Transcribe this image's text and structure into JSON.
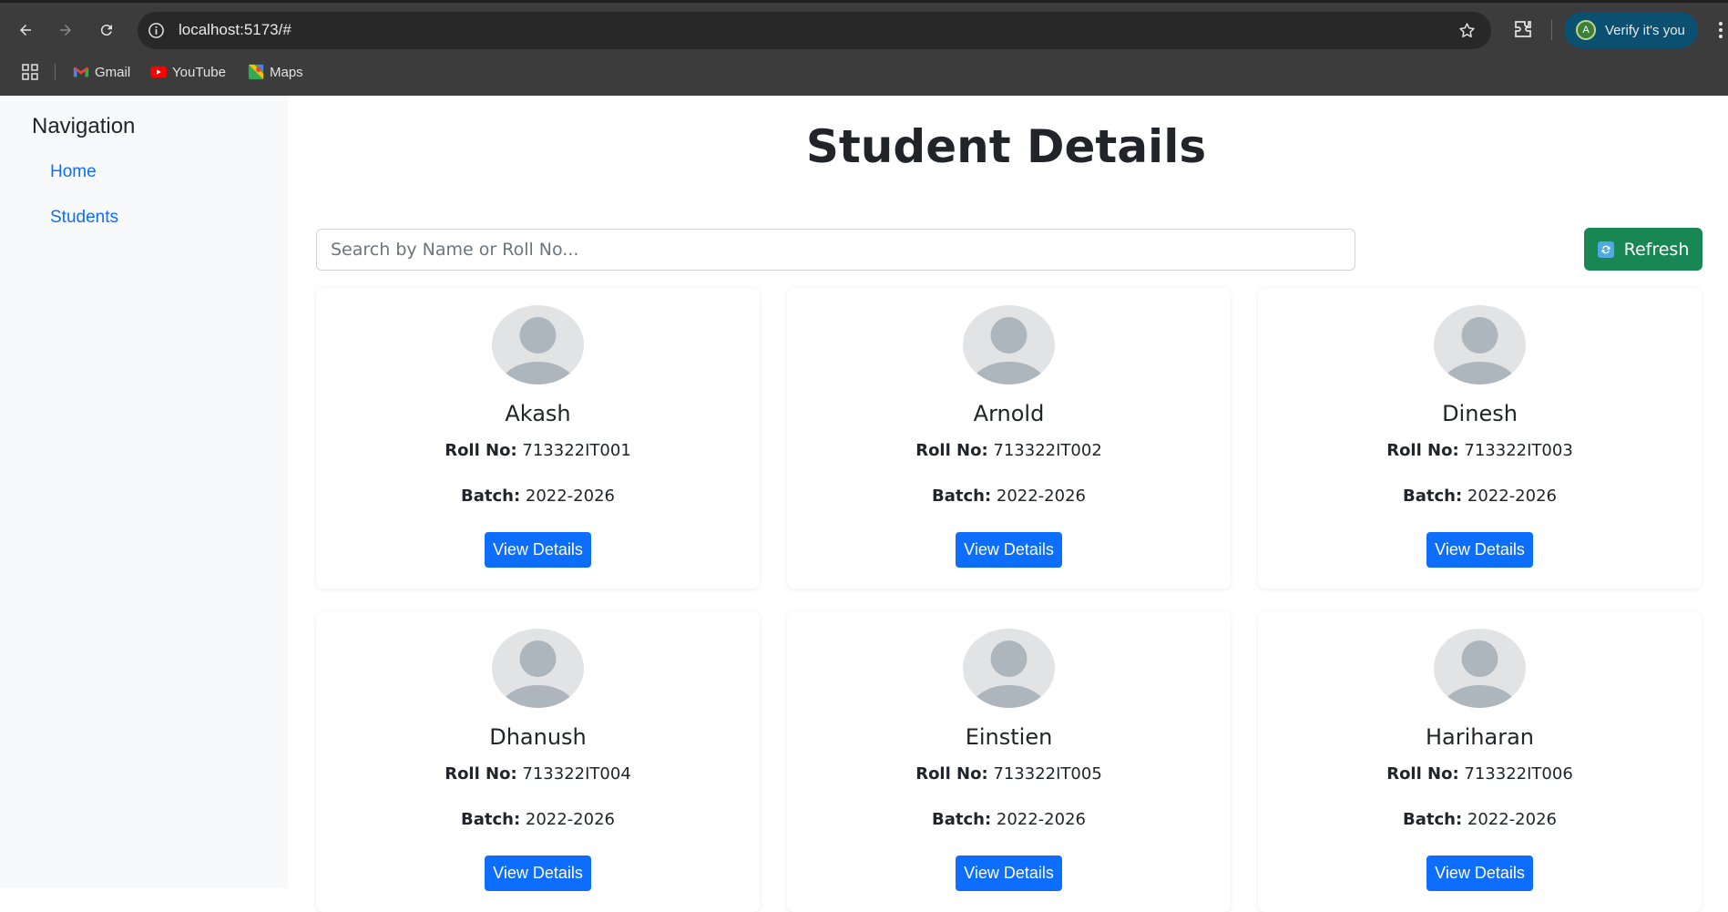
{
  "browser": {
    "url": "localhost:5173/#",
    "profile_label": "Verify it's you",
    "profile_initial": "A",
    "bookmarks": [
      {
        "label": "Gmail",
        "icon": "gmail-icon"
      },
      {
        "label": "YouTube",
        "icon": "youtube-icon"
      },
      {
        "label": "Maps",
        "icon": "maps-icon"
      }
    ]
  },
  "sidebar": {
    "title": "Navigation",
    "links": [
      {
        "label": "Home"
      },
      {
        "label": "Students"
      }
    ]
  },
  "main": {
    "title": "Student Details",
    "search_placeholder": "Search by Name or Roll No...",
    "refresh_label": "Refresh",
    "roll_label": "Roll No:",
    "batch_label": "Batch:",
    "view_label": "View Details",
    "students": [
      {
        "name": "Akash",
        "roll": "713322IT001",
        "batch": "2022-2026"
      },
      {
        "name": "Arnold",
        "roll": "713322IT002",
        "batch": "2022-2026"
      },
      {
        "name": "Dinesh",
        "roll": "713322IT003",
        "batch": "2022-2026"
      },
      {
        "name": "Dhanush",
        "roll": "713322IT004",
        "batch": "2022-2026"
      },
      {
        "name": "Einstien",
        "roll": "713322IT005",
        "batch": "2022-2026"
      },
      {
        "name": "Hariharan",
        "roll": "713322IT006",
        "batch": "2022-2026"
      }
    ]
  },
  "colors": {
    "primary": "#0d6efd",
    "success": "#198754",
    "sidebar_bg": "#f8f9fa",
    "chrome_bg": "#3c3c3c"
  }
}
